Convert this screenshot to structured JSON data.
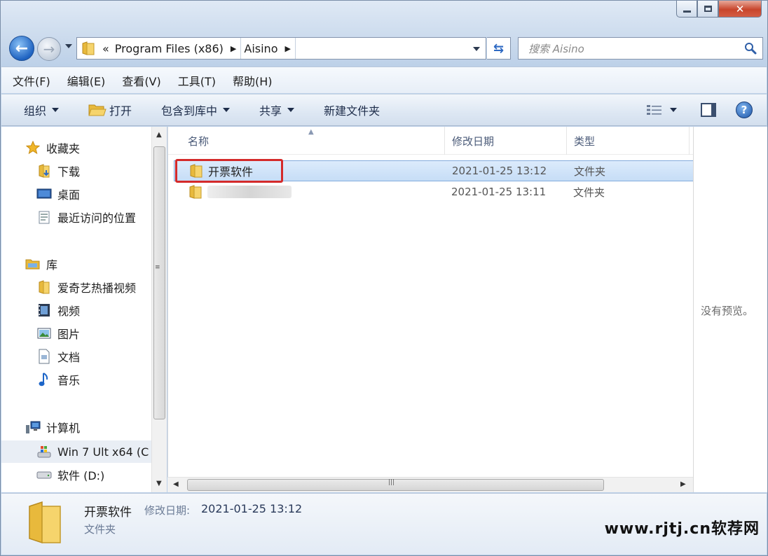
{
  "menu": [
    "文件(F)",
    "编辑(E)",
    "查看(V)",
    "工具(T)",
    "帮助(H)"
  ],
  "address": {
    "overflow": "«",
    "segments": [
      "Program Files (x86)",
      "Aisino"
    ]
  },
  "search": {
    "placeholder": "搜索 Aisino"
  },
  "toolbar": {
    "organize": "组织",
    "open": "打开",
    "include_library": "包含到库中",
    "share": "共享",
    "new_folder": "新建文件夹"
  },
  "nav": {
    "favorites": {
      "label": "收藏夹",
      "items": [
        "下载",
        "桌面",
        "最近访问的位置"
      ]
    },
    "libraries": {
      "label": "库",
      "items": [
        "爱奇艺热播视频",
        "视频",
        "图片",
        "文档",
        "音乐"
      ]
    },
    "computer": {
      "label": "计算机",
      "items": [
        "Win 7 Ult x64 (C",
        "软件 (D:)"
      ]
    }
  },
  "columns": {
    "name": "名称",
    "modified": "修改日期",
    "type": "类型"
  },
  "files": [
    {
      "name": "开票软件",
      "modified": "2021-01-25 13:12",
      "type": "文件夹",
      "selected": true
    },
    {
      "name": "",
      "modified": "2021-01-25 13:11",
      "type": "文件夹",
      "selected": false
    }
  ],
  "preview": {
    "text": "没有预览。"
  },
  "details": {
    "name": "开票软件",
    "modified_label": "修改日期:",
    "modified": "2021-01-25 13:12",
    "type": "文件夹"
  },
  "watermark": "www.rjtj.cn软荐网",
  "colors": {
    "accent": "#1f63c1",
    "selection": "#c6ddf6",
    "highlight_box": "#d42a2a",
    "folder": "#e8b93c"
  }
}
